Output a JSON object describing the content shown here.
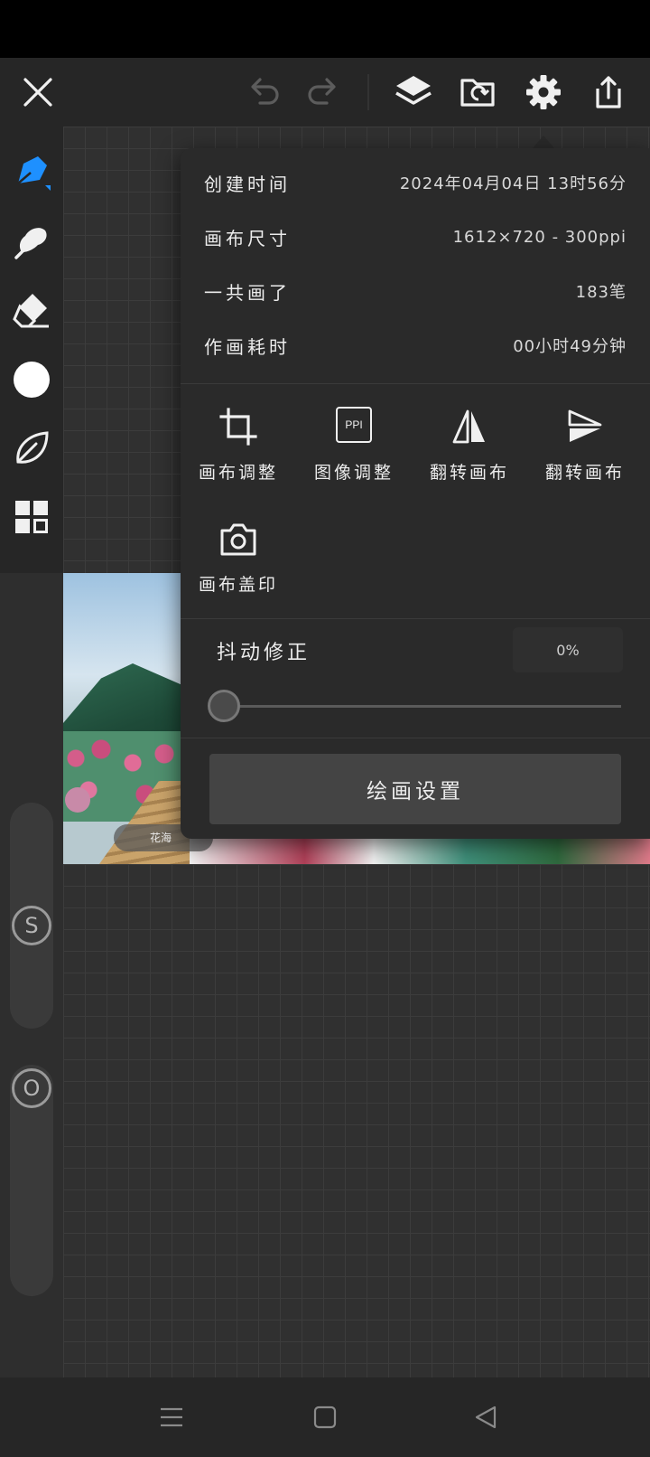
{
  "toolbar": {
    "icons": [
      "close-icon",
      "undo-icon",
      "redo-icon",
      "layers-icon",
      "import-icon",
      "settings-icon",
      "share-icon"
    ]
  },
  "left_tools": [
    "pen-icon",
    "smudge-icon",
    "eraser-icon",
    "color-picker",
    "leaf-icon",
    "grid-icon"
  ],
  "sliders": {
    "size_knob": "S",
    "opacity_knob": "O"
  },
  "popup": {
    "info": [
      {
        "label": "创建时间",
        "value": "2024年04月04日 13时56分"
      },
      {
        "label": "画布尺寸",
        "value": "1612×720 - 300ppi"
      },
      {
        "label": "一共画了",
        "value": "183笔"
      },
      {
        "label": "作画耗时",
        "value": "00小时49分钟"
      }
    ],
    "actions": [
      {
        "label": "画布调整",
        "icon": "crop-icon"
      },
      {
        "label": "图像调整",
        "icon": "ppi-icon",
        "icon_text": "PPI"
      },
      {
        "label": "翻转画布",
        "icon": "flip-horizontal-icon"
      },
      {
        "label": "翻转画布",
        "icon": "flip-vertical-icon"
      },
      {
        "label": "画布盖印",
        "icon": "camera-icon"
      }
    ],
    "jitter": {
      "label": "抖动修正",
      "value": "0%",
      "level": 0
    },
    "draw_settings_label": "绘画设置"
  },
  "canvas_overlay": {
    "chip_text": "花海"
  },
  "colors": {
    "accent": "#1e90ff",
    "panel": "#2a2a2a",
    "toolbar": "#262626"
  }
}
